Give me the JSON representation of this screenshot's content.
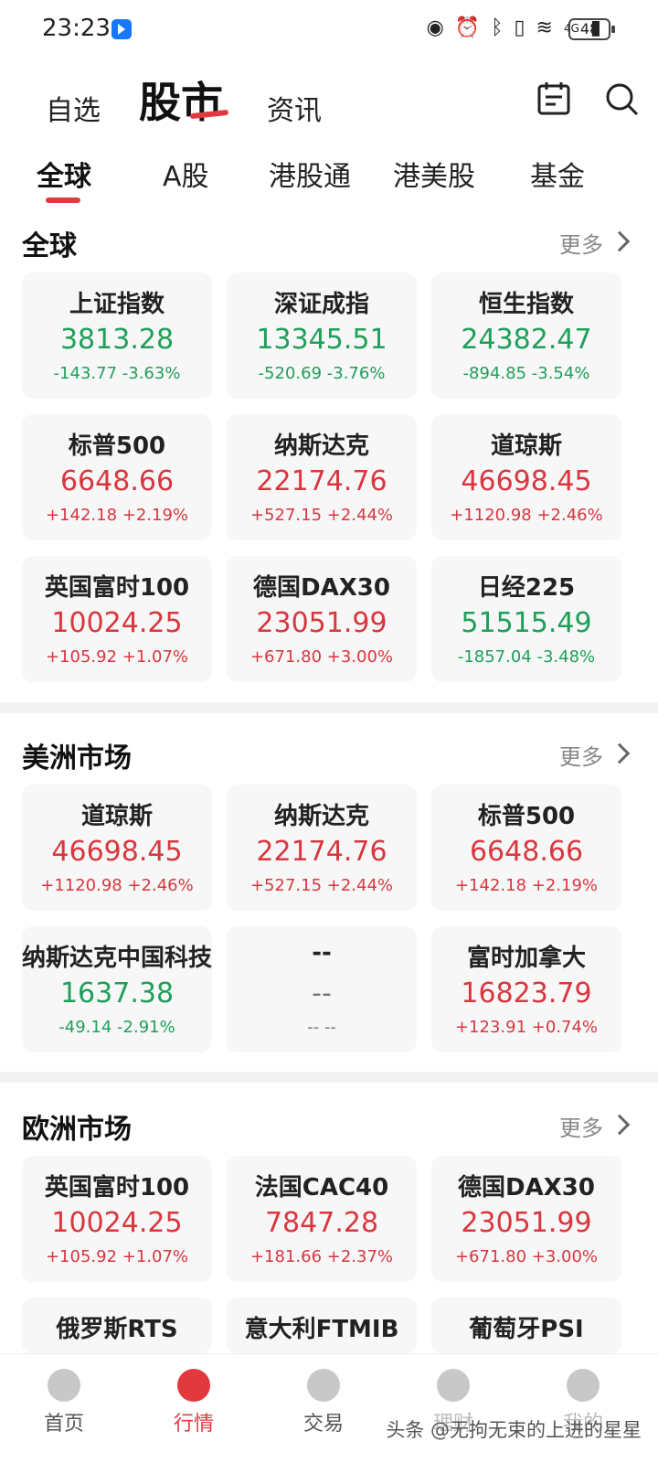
{
  "status_bar": {
    "time": "23:23",
    "battery": "48",
    "network": "4G"
  },
  "header": {
    "tabs": [
      {
        "label": "自选"
      },
      {
        "label": "股市"
      },
      {
        "label": "资讯"
      }
    ]
  },
  "category_tabs": [
    "全球",
    "A股",
    "港股通",
    "港美股",
    "基金"
  ],
  "sections": [
    {
      "title": "全球",
      "more": "更多",
      "cards": [
        {
          "name": "上证指数",
          "price": "3813.28",
          "change": "-143.77 -3.63%",
          "dir": "down"
        },
        {
          "name": "深证成指",
          "price": "13345.51",
          "change": "-520.69 -3.76%",
          "dir": "down"
        },
        {
          "name": "恒生指数",
          "price": "24382.47",
          "change": "-894.85 -3.54%",
          "dir": "down"
        },
        {
          "name": "标普500",
          "price": "6648.66",
          "change": "+142.18 +2.19%",
          "dir": "up"
        },
        {
          "name": "纳斯达克",
          "price": "22174.76",
          "change": "+527.15 +2.44%",
          "dir": "up"
        },
        {
          "name": "道琼斯",
          "price": "46698.45",
          "change": "+1120.98 +2.46%",
          "dir": "up"
        },
        {
          "name": "英国富时100",
          "price": "10024.25",
          "change": "+105.92 +1.07%",
          "dir": "up"
        },
        {
          "name": "德国DAX30",
          "price": "23051.99",
          "change": "+671.80 +3.00%",
          "dir": "up"
        },
        {
          "name": "日经225",
          "price": "51515.49",
          "change": "-1857.04 -3.48%",
          "dir": "down"
        }
      ]
    },
    {
      "title": "美洲市场",
      "more": "更多",
      "cards": [
        {
          "name": "道琼斯",
          "price": "46698.45",
          "change": "+1120.98 +2.46%",
          "dir": "up"
        },
        {
          "name": "纳斯达克",
          "price": "22174.76",
          "change": "+527.15 +2.44%",
          "dir": "up"
        },
        {
          "name": "标普500",
          "price": "6648.66",
          "change": "+142.18 +2.19%",
          "dir": "up"
        },
        {
          "name": "纳斯达克中国科技",
          "price": "1637.38",
          "change": "-49.14 -2.91%",
          "dir": "down"
        },
        {
          "name": "--",
          "price": "--",
          "change": "-- --",
          "dir": "flat"
        },
        {
          "name": "富时加拿大",
          "price": "16823.79",
          "change": "+123.91 +0.74%",
          "dir": "up"
        }
      ]
    },
    {
      "title": "欧洲市场",
      "more": "更多",
      "cards": [
        {
          "name": "英国富时100",
          "price": "10024.25",
          "change": "+105.92 +1.07%",
          "dir": "up"
        },
        {
          "name": "法国CAC40",
          "price": "7847.28",
          "change": "+181.66 +2.37%",
          "dir": "up"
        },
        {
          "name": "德国DAX30",
          "price": "23051.99",
          "change": "+671.80 +3.00%",
          "dir": "up"
        },
        {
          "name": "俄罗斯RTS",
          "price": "",
          "change": "",
          "dir": "flat"
        },
        {
          "name": "意大利FTMIB",
          "price": "",
          "change": "",
          "dir": "flat"
        },
        {
          "name": "葡萄牙PSI",
          "price": "",
          "change": "",
          "dir": "flat"
        }
      ]
    }
  ],
  "bottom_nav": [
    {
      "label": "首页",
      "icon": "home-icon"
    },
    {
      "label": "行情",
      "icon": "market-trend-icon",
      "active": true
    },
    {
      "label": "交易",
      "icon": "trade-exchange-icon"
    },
    {
      "label": "理财",
      "icon": "wealth-icon"
    },
    {
      "label": "我的",
      "icon": "profile-icon"
    }
  ],
  "watermark": "头条 @无拘无束的上进的星星",
  "colors": {
    "up": "#d9363e",
    "down": "#1f9f5a",
    "accent": "#e2393f"
  }
}
